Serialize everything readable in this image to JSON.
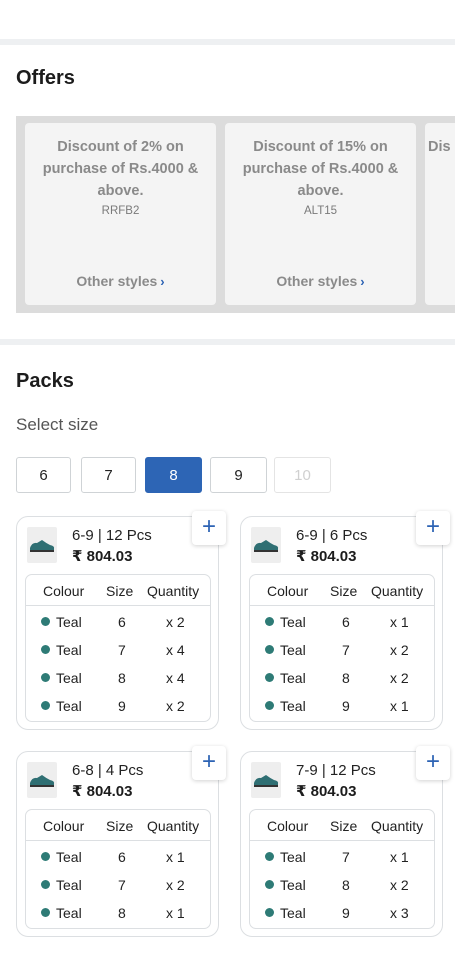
{
  "offers": {
    "title": "Offers",
    "items": [
      {
        "title": "Discount of 2% on purchase of Rs.4000 & above.",
        "code": "RRFB2",
        "link": "Other styles"
      },
      {
        "title": "Discount of 15% on purchase of Rs.4000 & above.",
        "code": "ALT15",
        "link": "Other styles"
      },
      {
        "title": "Dis",
        "code": "",
        "link": ""
      }
    ]
  },
  "packs": {
    "title": "Packs",
    "select_size_label": "Select size",
    "sizes": [
      {
        "label": "6",
        "state": "normal"
      },
      {
        "label": "7",
        "state": "normal"
      },
      {
        "label": "8",
        "state": "selected"
      },
      {
        "label": "9",
        "state": "normal"
      },
      {
        "label": "10",
        "state": "disabled"
      }
    ],
    "table_headers": {
      "colour": "Colour",
      "size": "Size",
      "quantity": "Quantity"
    },
    "cards": [
      {
        "name": "6-9 | 12 Pcs",
        "price": "₹ 804.03",
        "rows": [
          {
            "colour": "Teal",
            "size": "6",
            "qty": "x 2"
          },
          {
            "colour": "Teal",
            "size": "7",
            "qty": "x 4"
          },
          {
            "colour": "Teal",
            "size": "8",
            "qty": "x 4"
          },
          {
            "colour": "Teal",
            "size": "9",
            "qty": "x 2"
          }
        ]
      },
      {
        "name": "6-9 | 6 Pcs",
        "price": "₹ 804.03",
        "rows": [
          {
            "colour": "Teal",
            "size": "6",
            "qty": "x 1"
          },
          {
            "colour": "Teal",
            "size": "7",
            "qty": "x 2"
          },
          {
            "colour": "Teal",
            "size": "8",
            "qty": "x 2"
          },
          {
            "colour": "Teal",
            "size": "9",
            "qty": "x 1"
          }
        ]
      },
      {
        "name": "6-8 | 4 Pcs",
        "price": "₹ 804.03",
        "rows": [
          {
            "colour": "Teal",
            "size": "6",
            "qty": "x 1"
          },
          {
            "colour": "Teal",
            "size": "7",
            "qty": "x 2"
          },
          {
            "colour": "Teal",
            "size": "8",
            "qty": "x 1"
          }
        ]
      },
      {
        "name": "7-9 | 12 Pcs",
        "price": "₹ 804.03",
        "rows": [
          {
            "colour": "Teal",
            "size": "7",
            "qty": "x 1"
          },
          {
            "colour": "Teal",
            "size": "8",
            "qty": "x 2"
          },
          {
            "colour": "Teal",
            "size": "9",
            "qty": "x 3"
          }
        ]
      }
    ]
  },
  "colors": {
    "accent": "#2d65b5",
    "teal": "#2e7b76"
  },
  "icons": {
    "add": "plus-icon",
    "link_arrow": "chevron-right-icon",
    "product": "shoe-thumbnail"
  }
}
